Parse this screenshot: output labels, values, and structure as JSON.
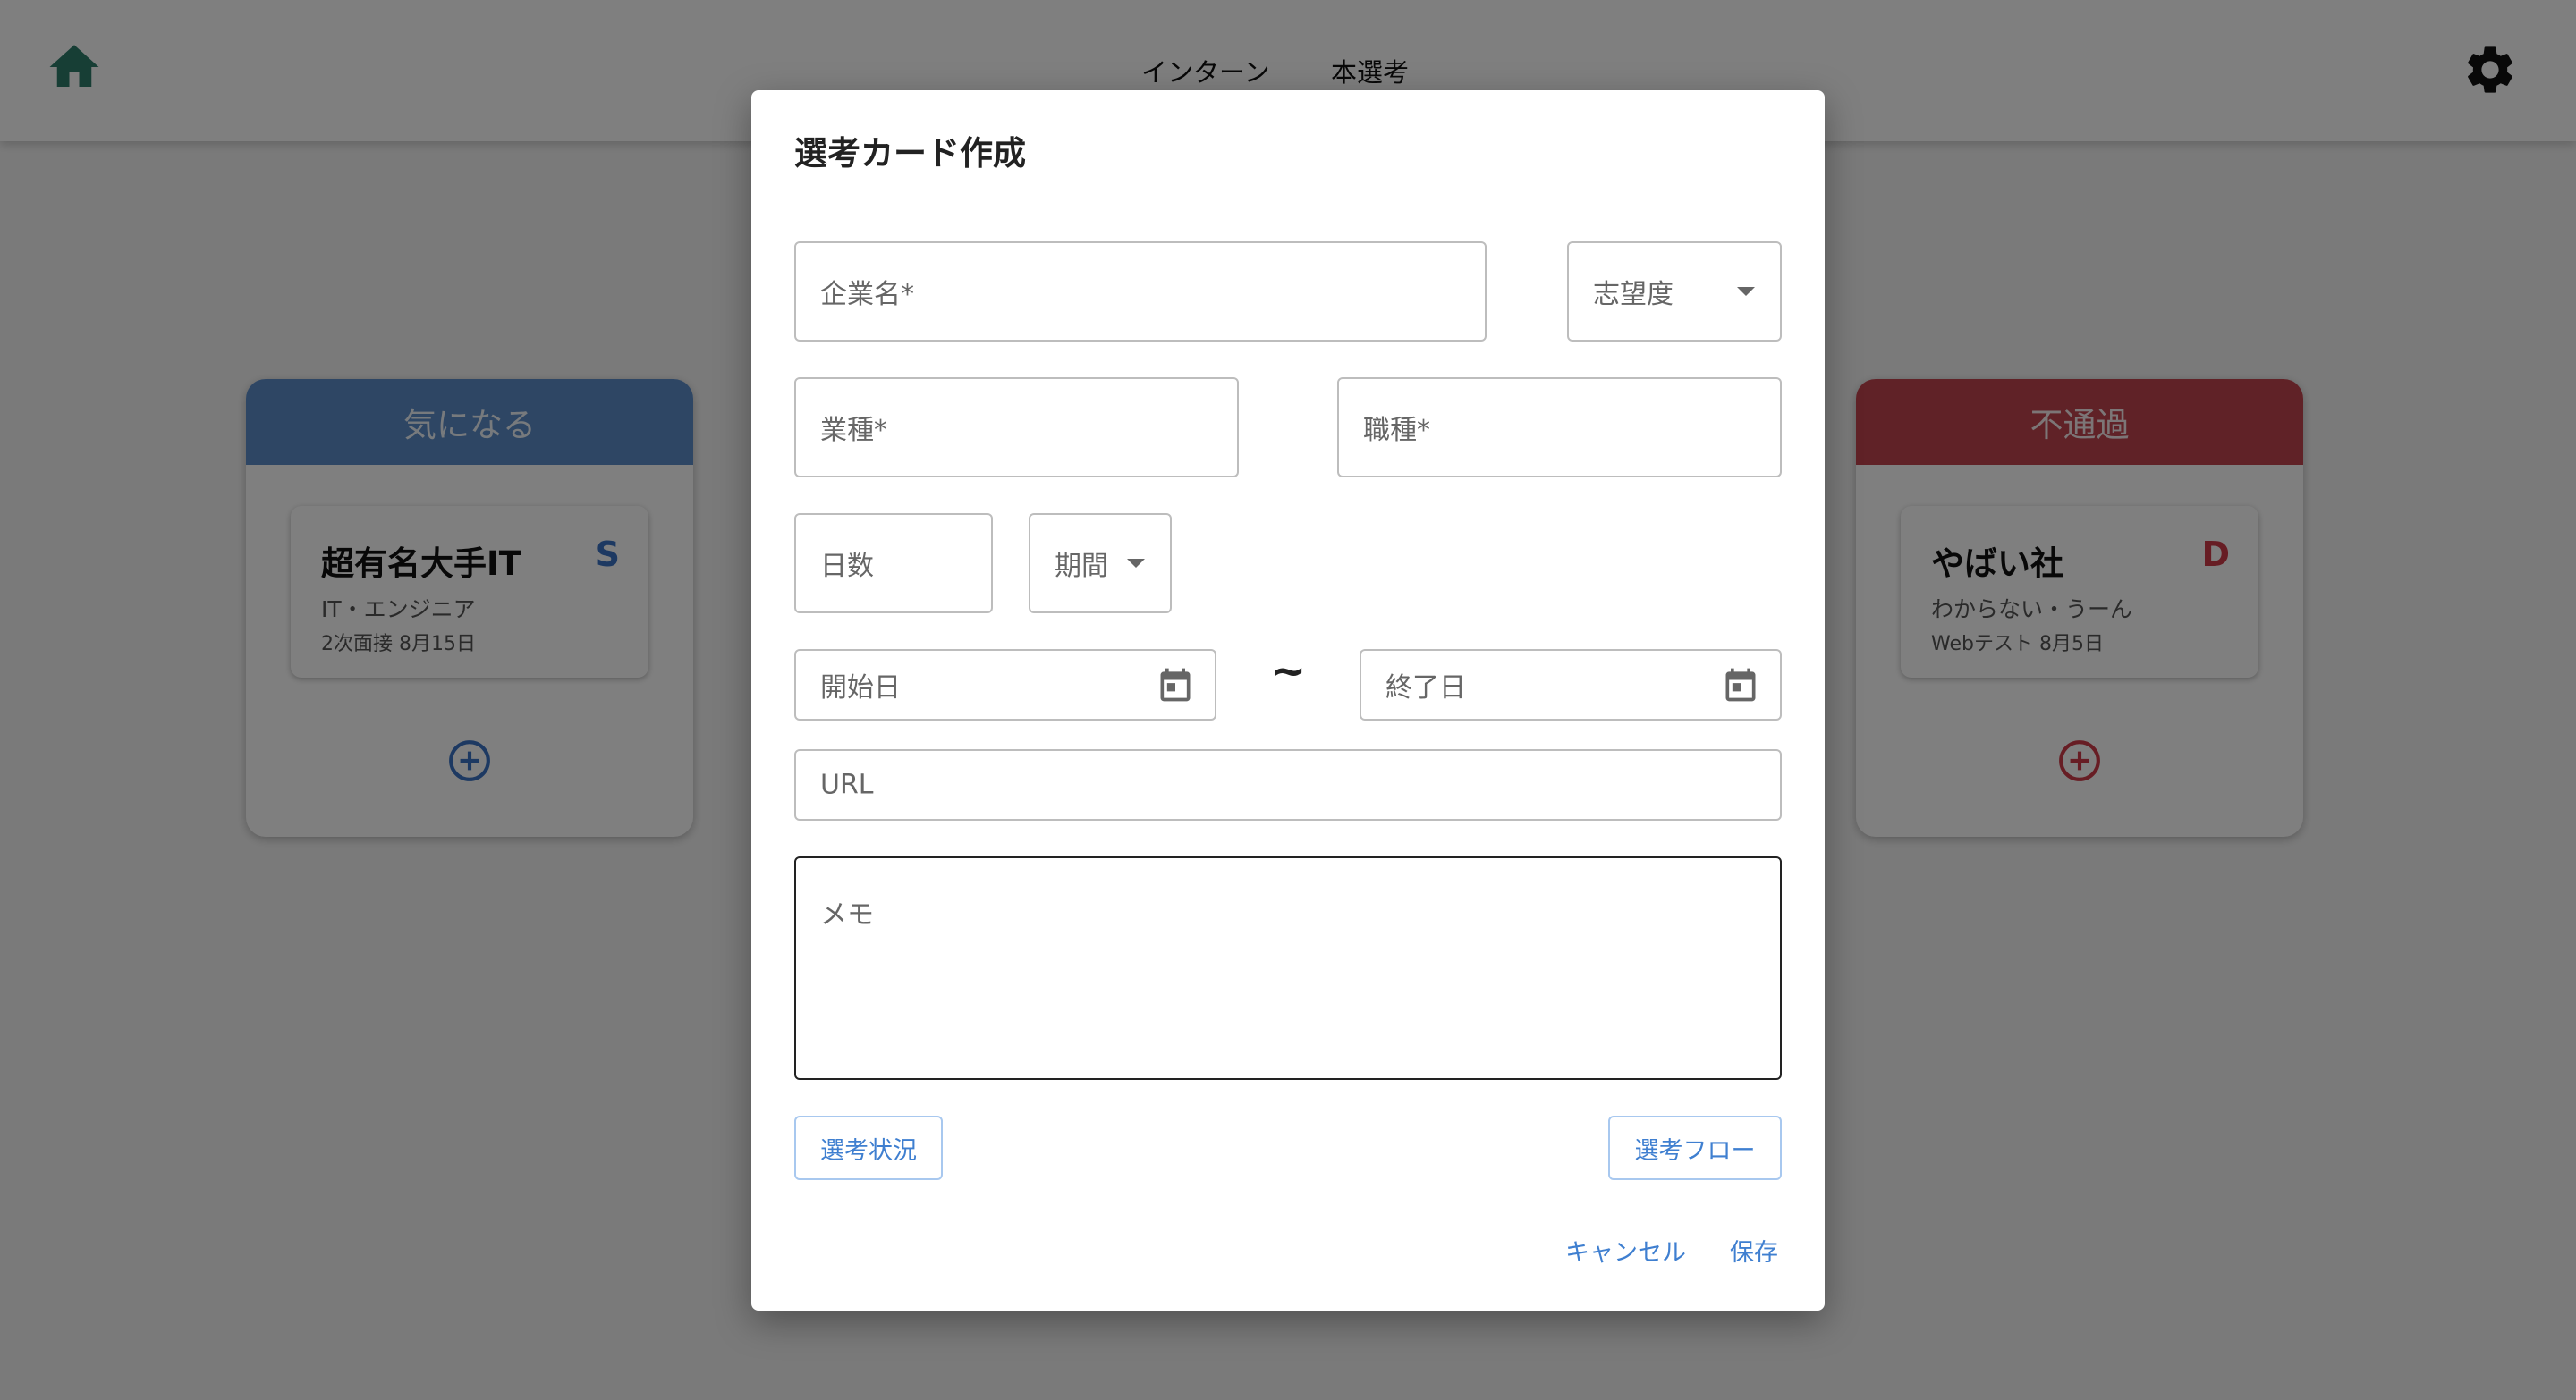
{
  "header": {
    "tabs": [
      {
        "label": "インターン"
      },
      {
        "label": "本選考"
      }
    ],
    "icons": {
      "home": "home-icon",
      "settings": "gear-icon"
    }
  },
  "columns": [
    {
      "title": "気になる",
      "color": "#5c8dc9",
      "card": {
        "company": "超有名大手IT",
        "rank": "S",
        "category": "IT・エンジニア",
        "step": "2次面接 8月15日"
      }
    },
    {
      "title": "不通過",
      "color": "#c0454f",
      "card": {
        "company": "やばい社",
        "rank": "D",
        "category": "わからない・うーん",
        "step": "Webテスト 8月5日"
      }
    }
  ],
  "dialog": {
    "title": "選考カード作成",
    "fields": {
      "company_name": {
        "label": "企業名",
        "required": "*"
      },
      "preference": {
        "label": "志望度"
      },
      "industry": {
        "label": "業種",
        "required": "*"
      },
      "job_type": {
        "label": "職種",
        "required": "*"
      },
      "days": {
        "label": "日数"
      },
      "period": {
        "label": "期間"
      },
      "start_date": {
        "label": "開始日"
      },
      "end_date": {
        "label": "終了日"
      },
      "url": {
        "label": "URL"
      },
      "memo": {
        "label": "メモ"
      }
    },
    "range_separator": "~",
    "buttons": {
      "status": "選考状況",
      "flow": "選考フロー",
      "cancel": "キャンセル",
      "save": "保存"
    }
  }
}
